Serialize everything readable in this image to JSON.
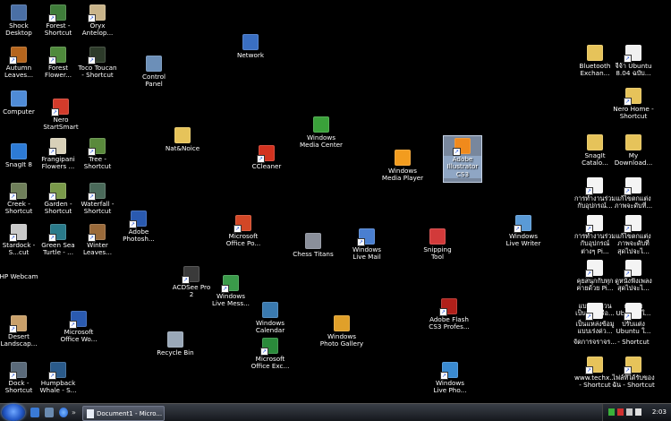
{
  "desktop": {
    "icons": [
      {
        "name": "shock-desktop-icon",
        "label": "Shock\nDesktop",
        "color": "#4a6fa5",
        "shortcut": false
      },
      {
        "name": "forest-shortcut-icon",
        "label": "Forest -\nShortcut",
        "color": "#3f7d3a",
        "shortcut": true
      },
      {
        "name": "oryx-antelope-icon",
        "label": "Oryx\nAntelop...",
        "color": "#c9b48a",
        "shortcut": true
      },
      {
        "name": "autumn-leaves-icon",
        "label": "Autumn\nLeaves...",
        "color": "#b5651d",
        "shortcut": true
      },
      {
        "name": "forest-flower-icon",
        "label": "Forest\nFlower...",
        "color": "#4f8a3c",
        "shortcut": true
      },
      {
        "name": "toco-toucan-icon",
        "label": "Toco Toucan\n- Shortcut",
        "color": "#2d3b2a",
        "shortcut": true
      },
      {
        "name": "control-panel-icon",
        "label": "Control\nPanel",
        "color": "#6c8fb8",
        "shortcut": false
      },
      {
        "name": "network-icon",
        "label": "Network",
        "color": "#3a6fc2",
        "shortcut": false
      },
      {
        "name": "computer-icon",
        "label": "Computer",
        "color": "#4f8bd6",
        "shortcut": false
      },
      {
        "name": "nero-startsmart-icon",
        "label": "Nero\nStartSmart",
        "color": "#d23b2b",
        "shortcut": true
      },
      {
        "name": "snagit-8-icon",
        "label": "SnagIt 8",
        "color": "#2d7bd6",
        "shortcut": false
      },
      {
        "name": "frangipani-flowers-icon",
        "label": "Frangipani\nFlowers ...",
        "color": "#d8d0b8",
        "shortcut": true
      },
      {
        "name": "tree-shortcut-icon",
        "label": "Tree -\nShortcut",
        "color": "#5a8a3c",
        "shortcut": true
      },
      {
        "name": "nat-noice-folder-icon",
        "label": "Nat&Noice",
        "color": "#e6c35a",
        "shortcut": false
      },
      {
        "name": "ccleaner-icon",
        "label": "CCleaner",
        "color": "#d2321f",
        "shortcut": true
      },
      {
        "name": "windows-media-center-icon",
        "label": "Windows\nMedia Center",
        "color": "#3aa13a",
        "shortcut": false
      },
      {
        "name": "windows-media-player-icon",
        "label": "Windows\nMedia Player",
        "color": "#f29c1f",
        "shortcut": false
      },
      {
        "name": "adobe-illustrator-cs3-icon",
        "label": "Adobe\nIllustrator\nCS3",
        "color": "#f08a1c",
        "shortcut": true
      },
      {
        "name": "creek-shortcut-icon",
        "label": "Creek -\nShortcut",
        "color": "#6f7f5a",
        "shortcut": true
      },
      {
        "name": "garden-shortcut-icon",
        "label": "Garden -\nShortcut",
        "color": "#7a9a4a",
        "shortcut": true
      },
      {
        "name": "waterfall-shortcut-icon",
        "label": "Waterfall -\nShortcut",
        "color": "#4a6a5a",
        "shortcut": true
      },
      {
        "name": "adobe-photoshop-icon",
        "label": "Adobe\nPhotosh...",
        "color": "#2a5ab0",
        "shortcut": true
      },
      {
        "name": "microsoft-office-powerpoint-icon",
        "label": "Microsoft\nOffice Po...",
        "color": "#d24726",
        "shortcut": true
      },
      {
        "name": "chess-titans-icon",
        "label": "Chess Titans",
        "color": "#8a8f9a",
        "shortcut": false
      },
      {
        "name": "windows-live-mail-icon",
        "label": "Windows\nLive Mail",
        "color": "#4a7fd0",
        "shortcut": true
      },
      {
        "name": "snipping-tool-icon",
        "label": "Snipping\nTool",
        "color": "#d23a3a",
        "shortcut": false
      },
      {
        "name": "windows-live-writer-icon",
        "label": "Windows\nLive Writer",
        "color": "#5a9ad6",
        "shortcut": true
      },
      {
        "name": "stardock-icon",
        "label": "Stardock -\nS...cut",
        "color": "#c9c9c9",
        "shortcut": true
      },
      {
        "name": "green-sea-turtle-icon",
        "label": "Green Sea\nTurtle - ...",
        "color": "#2a7a8a",
        "shortcut": true
      },
      {
        "name": "winter-leaves-icon",
        "label": "Winter\nLeaves...",
        "color": "#9a6a3a",
        "shortcut": true
      },
      {
        "name": "hp-webcam-icon",
        "label": "HP Webcam",
        "color": "#6a7a9a",
        "shortcut": false
      },
      {
        "name": "acdsee-pro-2-icon",
        "label": "ACDSee Pro\n2",
        "color": "#3a3a3a",
        "shortcut": true
      },
      {
        "name": "windows-live-messenger-icon",
        "label": "Windows\nLive Mess...",
        "color": "#3a9a4a",
        "shortcut": true
      },
      {
        "name": "windows-calendar-icon",
        "label": "Windows\nCalendar",
        "color": "#3a7ab0",
        "shortcut": false
      },
      {
        "name": "windows-photo-gallery-icon",
        "label": "Windows\nPhoto Gallery",
        "color": "#e0a02a",
        "shortcut": false
      },
      {
        "name": "adobe-flash-cs3-icon",
        "label": "Adobe Flash\nCS3 Profes...",
        "color": "#b0201a",
        "shortcut": true
      },
      {
        "name": "desert-landscape-icon",
        "label": "Desert\nLandscap...",
        "color": "#c9a06a",
        "shortcut": true
      },
      {
        "name": "microsoft-office-word-icon",
        "label": "Microsoft\nOffice Wo...",
        "color": "#2a5ab0",
        "shortcut": true
      },
      {
        "name": "recycle-bin-icon",
        "label": "Recycle Bin",
        "color": "#9aa8b8",
        "shortcut": false
      },
      {
        "name": "microsoft-office-excel-icon",
        "label": "Microsoft\nOffice Exc...",
        "color": "#2a8a3a",
        "shortcut": true
      },
      {
        "name": "dock-shortcut-icon",
        "label": "Dock -\nShortcut",
        "color": "#5a6a7a",
        "shortcut": true
      },
      {
        "name": "humpback-whale-icon",
        "label": "Humpback\nWhale - S...",
        "color": "#2a5a8a",
        "shortcut": true
      },
      {
        "name": "windows-live-photo-icon",
        "label": "Windows\nLive Pho...",
        "color": "#3a8ad0",
        "shortcut": true
      },
      {
        "name": "bluetooth-exchange-folder-icon",
        "label": "Bluetooth\nExchan...",
        "color": "#e6c35a",
        "shortcut": false
      },
      {
        "name": "ubuntu-804-icon",
        "label": "จีจ้า Ubuntu\n8.04 ฉบับ...",
        "color": "#f0f0f0",
        "shortcut": true
      },
      {
        "name": "nero-home-icon",
        "label": "Nero Home -\nShortcut",
        "color": "#e6c35a",
        "shortcut": true
      },
      {
        "name": "snagit-catalog-folder-icon",
        "label": "SnagIt\nCatalo...",
        "color": "#e6c35a",
        "shortcut": false
      },
      {
        "name": "my-downloads-folder-icon",
        "label": "My\nDownload...",
        "color": "#e6c35a",
        "shortcut": false
      },
      {
        "name": "thai-doc-1-icon",
        "label": "การทำงานร่วม\nกับอุปกรณ์...",
        "color": "#f4f4f4",
        "shortcut": true
      },
      {
        "name": "thai-doc-2-icon",
        "label": "แก้ไขตกแต่ง\nภาพจะดับที่...",
        "color": "#f4f4f4",
        "shortcut": true
      },
      {
        "name": "thai-doc-3-icon",
        "label": "การทำงานร่วม\nกับอุปกรณ์\nต่างๆ Pi...",
        "color": "#f4f4f4",
        "shortcut": true
      },
      {
        "name": "thai-doc-4-icon",
        "label": "แก้ไขตกแต่ง\nภาพจะดับที่\nสุดไปจะไ...",
        "color": "#f4f4f4",
        "shortcut": true
      },
      {
        "name": "thai-doc-5-icon",
        "label": "คุยสนุกกับทุก\nค่ายด้วย Pi...",
        "color": "#f4f4f4",
        "shortcut": true
      },
      {
        "name": "thai-doc-6-icon",
        "label": "ดูหนังฟังเพลง\nสุดไปจะไ...",
        "color": "#f4f4f4",
        "shortcut": true
      },
      {
        "name": "thai-doc-7-icon",
        "label": "แบบเร่งด่วน\nเป็นแรงหรือ...",
        "color": "#f4f4f4",
        "shortcut": true
      },
      {
        "name": "thai-doc-8-icon",
        "label": "ต่อเติม\nUbuntu ใ...",
        "color": "#f4f4f4",
        "shortcut": true
      },
      {
        "name": "thai-doc-9-icon",
        "label": "เป็นแหล่งข้อมู\nแบบเร่งด่ว...",
        "color": "#f4f4f4",
        "shortcut": true
      },
      {
        "name": "thai-doc-10-icon",
        "label": "ปรับแต่ง\nUbuntu ใ...",
        "color": "#f4f4f4",
        "shortcut": true
      },
      {
        "name": "thai-doc-11-icon",
        "label": "จัดการจราจร...",
        "color": "#f4f4f4",
        "shortcut": false
      },
      {
        "name": "thai-doc-12-icon",
        "label": "- Shortcut",
        "color": "#f4f4f4",
        "shortcut": false
      },
      {
        "name": "www-techx-icon",
        "label": "www.techx...\n- Shortcut",
        "color": "#e6c35a",
        "shortcut": true
      },
      {
        "name": "thai-folder-shortcut-icon",
        "label": "ไฟล์ที่ได้รับของ\nฉัน - Shortcut",
        "color": "#e6c35a",
        "shortcut": true
      }
    ]
  },
  "taskbar": {
    "window_title": "Document1 - Micro...",
    "clock": "2:03",
    "start_color": "#2459c7"
  }
}
